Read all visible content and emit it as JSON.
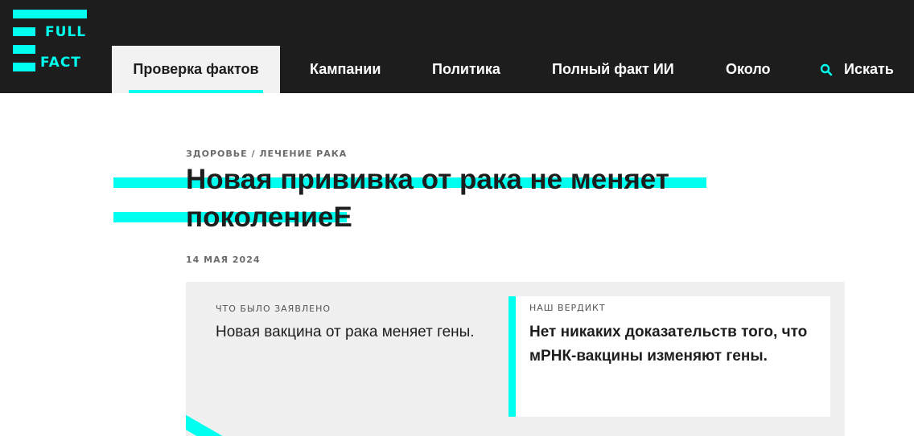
{
  "logo": {
    "line1": "FULL",
    "line2": "FACT"
  },
  "nav": {
    "items": [
      {
        "label": "Проверка фактов",
        "active": true
      },
      {
        "label": "Кампании"
      },
      {
        "label": "Политика"
      },
      {
        "label": "Полный факт ИИ"
      },
      {
        "label": "Около"
      }
    ],
    "search_label": "Искать"
  },
  "article": {
    "breadcrumb": "ЗДОРОВЬЕ / ЛЕЧЕНИЕ РАКА",
    "title": "Новая прививка от рака не меняет поколениеЕ",
    "date": "14 МАЯ 2024"
  },
  "claim": {
    "label": "ЧТО БЫЛО ЗАЯВЛЕНО",
    "text": "Новая вакцина от рака меняет гены."
  },
  "verdict": {
    "label": "НАШ ВЕРДИКТ",
    "text": "Нет никаких доказательств того, что мРНК-вакцины изменяют гены."
  },
  "colors": {
    "accent": "#00ffee",
    "header_bg": "#1d1d1d",
    "panel_bg": "#f0f0f0"
  }
}
